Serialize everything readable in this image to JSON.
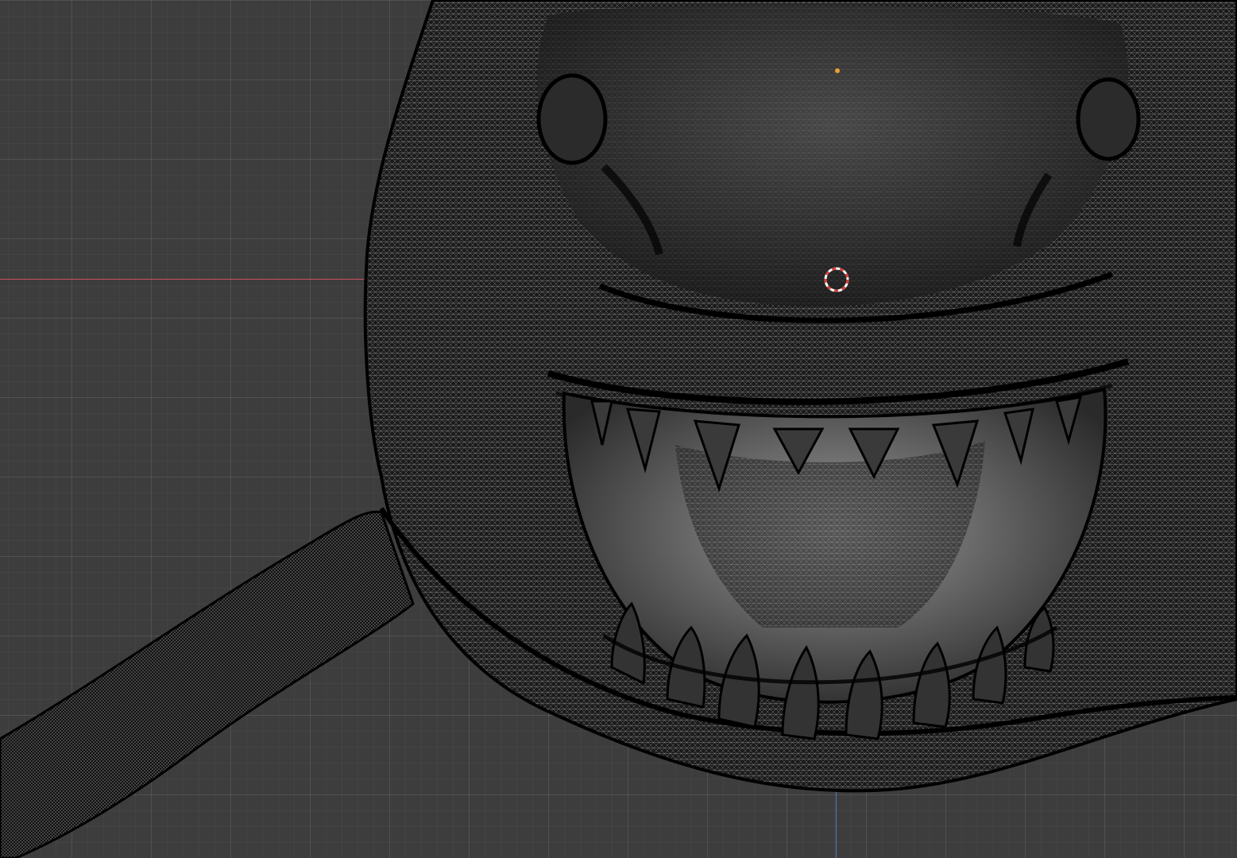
{
  "viewport": {
    "mode": "wireframe-overlay",
    "background_color": "#3d3d3d",
    "grid_color": "#4a4a4a",
    "x_axis_color": "#c8515b",
    "z_axis_color": "#4d7ac3",
    "mesh_color": "#1a1a1a",
    "wire_color": "#e6e6e6",
    "origin_color": "#f0a030",
    "cursor_color": "#d8403a"
  },
  "icons": [
    "3d-cursor-icon",
    "object-origin-icon"
  ]
}
